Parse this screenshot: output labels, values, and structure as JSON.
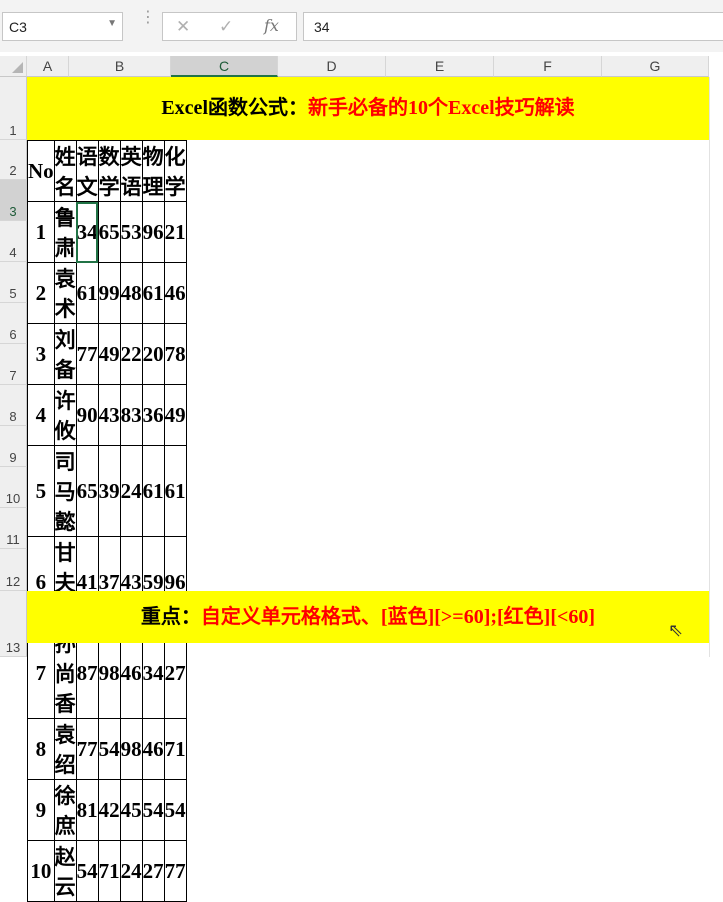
{
  "namebox": {
    "value": "C3"
  },
  "formula_bar": {
    "cancel_icon": "close-icon",
    "enter_icon": "check-icon",
    "fx_label": "fx",
    "value": "34"
  },
  "columns": [
    "A",
    "B",
    "C",
    "D",
    "E",
    "F",
    "G"
  ],
  "rows": [
    "1",
    "2",
    "3",
    "4",
    "5",
    "6",
    "7",
    "8",
    "9",
    "10",
    "11",
    "12",
    "13"
  ],
  "selected_cell": "C3",
  "title": {
    "part1": "Excel函数公式：",
    "part2": "新手必备的10个Excel技巧解读"
  },
  "table": {
    "headers": [
      "No",
      "姓名",
      "语文",
      "数学",
      "英语",
      "物理",
      "化学"
    ],
    "rows": [
      [
        "1",
        "鲁肃",
        "34",
        "65",
        "53",
        "96",
        "21"
      ],
      [
        "2",
        "袁术",
        "61",
        "99",
        "48",
        "61",
        "46"
      ],
      [
        "3",
        "刘备",
        "77",
        "49",
        "22",
        "20",
        "78"
      ],
      [
        "4",
        "许攸",
        "90",
        "43",
        "83",
        "36",
        "49"
      ],
      [
        "5",
        "司马懿",
        "65",
        "39",
        "24",
        "61",
        "61"
      ],
      [
        "6",
        "甘夫人",
        "41",
        "37",
        "43",
        "59",
        "96"
      ],
      [
        "7",
        "孙尚香",
        "87",
        "98",
        "46",
        "34",
        "27"
      ],
      [
        "8",
        "袁绍",
        "77",
        "54",
        "98",
        "46",
        "71"
      ],
      [
        "9",
        "徐庶",
        "81",
        "42",
        "45",
        "54",
        "54"
      ],
      [
        "10",
        "赵云",
        "54",
        "71",
        "24",
        "27",
        "77"
      ]
    ]
  },
  "footer": {
    "part1": "重点：",
    "part2": "自定义单元格格式、[蓝色][>=60];[红色][<60]"
  },
  "colors": {
    "banner": "#ffff00",
    "accent_red": "#ff0000",
    "selection_green": "#217346"
  }
}
